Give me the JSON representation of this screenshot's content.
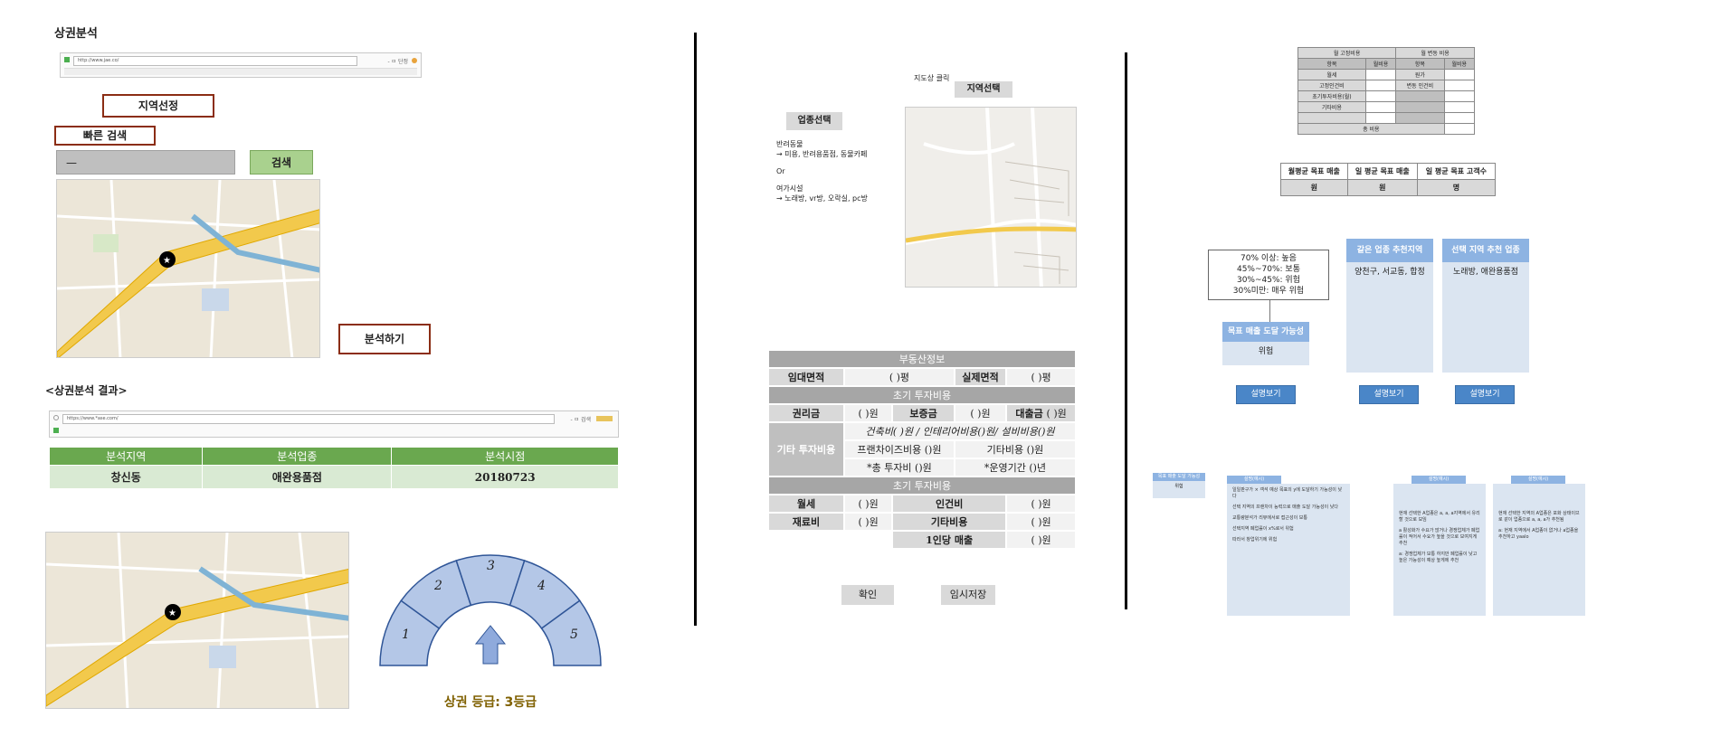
{
  "left": {
    "title": "상권분석",
    "browser1": {
      "url": "http://www.jae.co/",
      "addr_extra": "- ㅁ 단정"
    },
    "region_btn": "지역선정",
    "quick_search": "빠른 검색",
    "search_input": "—",
    "search_btn": "검색",
    "analyze_btn": "분석하기",
    "result_heading": "<상권분석 결과>",
    "browser2": {
      "url": "https://www.*ase.com/",
      "addr_extra": "- ㅁ 검색"
    },
    "result_table": {
      "headers": [
        "분석지역",
        "분석업종",
        "분석시점"
      ],
      "row": [
        "창신동",
        "애완용품점",
        "20180723"
      ]
    },
    "gauge": {
      "segments": [
        "1",
        "2",
        "3",
        "4",
        "5"
      ],
      "active": 3,
      "label": "상권 등급: 3등급"
    }
  },
  "middle": {
    "map_hint": "지도상 클릭",
    "region_select": "지역선택",
    "category_select": "업종선택",
    "category_text": [
      "반려동물",
      "→ 미용, 반려용품점, 동물카페",
      "Or",
      "여가시설",
      "→ 노래방, vr방, 오락실, pc방"
    ],
    "realestate": {
      "title": "부동산정보",
      "area_label": "임대면적",
      "area_val": "(   )평",
      "real_area_label": "실제면적",
      "real_area_val": "(   )평",
      "init_title": "초기 투자비용",
      "premium_label": "권리금",
      "premium_val": "(   )원",
      "deposit_label": "보증금",
      "deposit_val": "(   )원",
      "loan_label": "대출금",
      "loan_val": "(   )원",
      "other_label": "기타 투자비용",
      "other_line1": "건축비(   )원 / 인테리어비용()원/ 설비비용()원",
      "franchise": "프랜차이즈비용 ()원",
      "etc_cost": "기타비용 ()원",
      "total_invest": "*총 투자비 ()원",
      "period": "*운영기간 ()년",
      "init_title2": "초기 투자비용",
      "rent_label": "월세",
      "rent_val": "(   )원",
      "labor_label": "인건비",
      "labor_val": "(   )원",
      "material_label": "재료비",
      "material_val": "(   )원",
      "etc_label": "기타비용",
      "etc_val": "(   )원",
      "per_person_label": "1인당 매출",
      "per_person_val": "(   )원"
    },
    "confirm_btn": "확인",
    "save_btn": "임시저장"
  },
  "right": {
    "cost_table": {
      "fixed_head": "월 고정비용",
      "var_head": "월 변동 비용",
      "cols": [
        "항목",
        "월비용",
        "항목",
        "월비용"
      ],
      "rows": [
        [
          "월세",
          "",
          "원가",
          ""
        ],
        [
          "고정인건비",
          "",
          "변동 인건비",
          ""
        ],
        [
          "초기투자비용(월)",
          "",
          "",
          ""
        ],
        [
          "기타비용",
          "",
          "",
          ""
        ],
        [
          "",
          "",
          "",
          ""
        ]
      ],
      "total": "총 비용"
    },
    "target_table": {
      "headers": [
        "월평균 목표 매출",
        "일 평균 목표 매출",
        "일 평균 목표 고객수"
      ],
      "units": [
        "원",
        "원",
        "명"
      ]
    },
    "legend": [
      "70% 이상: 높음",
      "45%~70%: 보통",
      "30%~45%: 위험",
      "30%미만: 매우 위험"
    ],
    "col1": {
      "head": "목표 매출 도달 가능성",
      "value": "위험"
    },
    "col2": {
      "head": "같은 업종 추천지역",
      "value": "양천구, 서교동, 합정"
    },
    "col3": {
      "head": "선택 지역 추천 업종",
      "value": "노래방, 애완용품점"
    },
    "explain_btn": "설명보기",
    "small_box": {
      "head": "목표 매출 도달 가능성",
      "value": "위험"
    },
    "panel1": {
      "head": "설명(예시)",
      "lines": [
        "일일판구가 × 객석 예상 목표의 y에 도달하기 가능성이 낮다",
        "선택 지역의 프랜차이 능력으로 매출 도달 가능성이 낮다",
        "교통량분석가 리뷰에서로 접근성이 보통",
        "선택지역 폐업률이 x%로서 위험",
        "따라서 창업위기에 위험"
      ]
    },
    "panel2": {
      "head": "설명(예시)",
      "lines": [
        "현재 선택한 A업종은 a, a, a지역에서 유리할 것으로 보임",
        "a 활성화가 수요가 많거나 경쟁업체가 폐업률이 적어서 수요가 높을 것으로 보여지게 추천",
        "a: 경쟁업체가 보통 하지만 폐업률이 낮고 높은 가능성이 예상 높게에 추천"
      ]
    },
    "panel3": {
      "head": "설명(예시)",
      "lines": [
        "현재 선택한 지역의 A업종은 포화 상태이므로 같이 업종으로 a, a, a가 추천됨",
        "a: 현재 지역에서 A업종이 없거나 a업종을 추천하고 yaalo"
      ]
    }
  },
  "colors": {
    "green": "#6aa84f",
    "lightgreen": "#d9ead3",
    "gauge": "#b4c7e7",
    "navy": "#2f5597",
    "brown": "#8b2d14"
  }
}
